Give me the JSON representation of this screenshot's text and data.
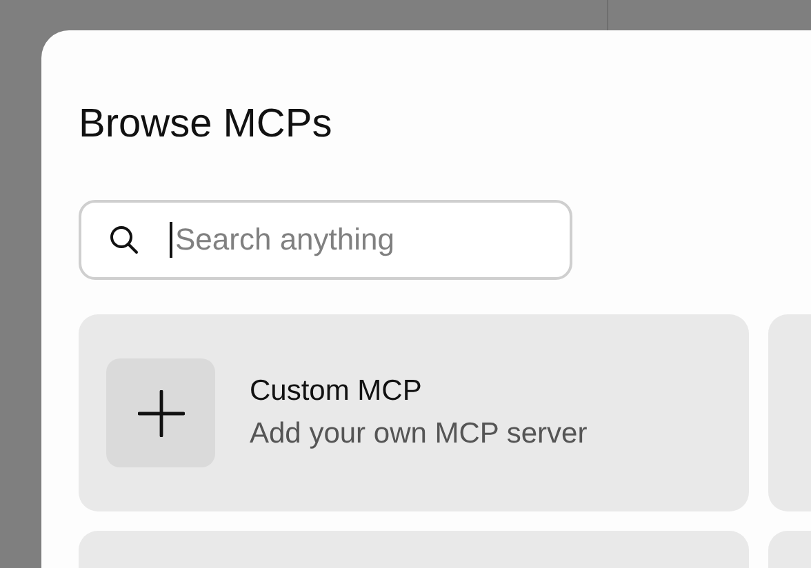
{
  "dialog": {
    "title": "Browse MCPs"
  },
  "search": {
    "placeholder": "Search anything"
  },
  "cards": [
    {
      "kind": "custom",
      "title": "Custom MCP",
      "subtitle": "Add your own MCP server"
    }
  ]
}
